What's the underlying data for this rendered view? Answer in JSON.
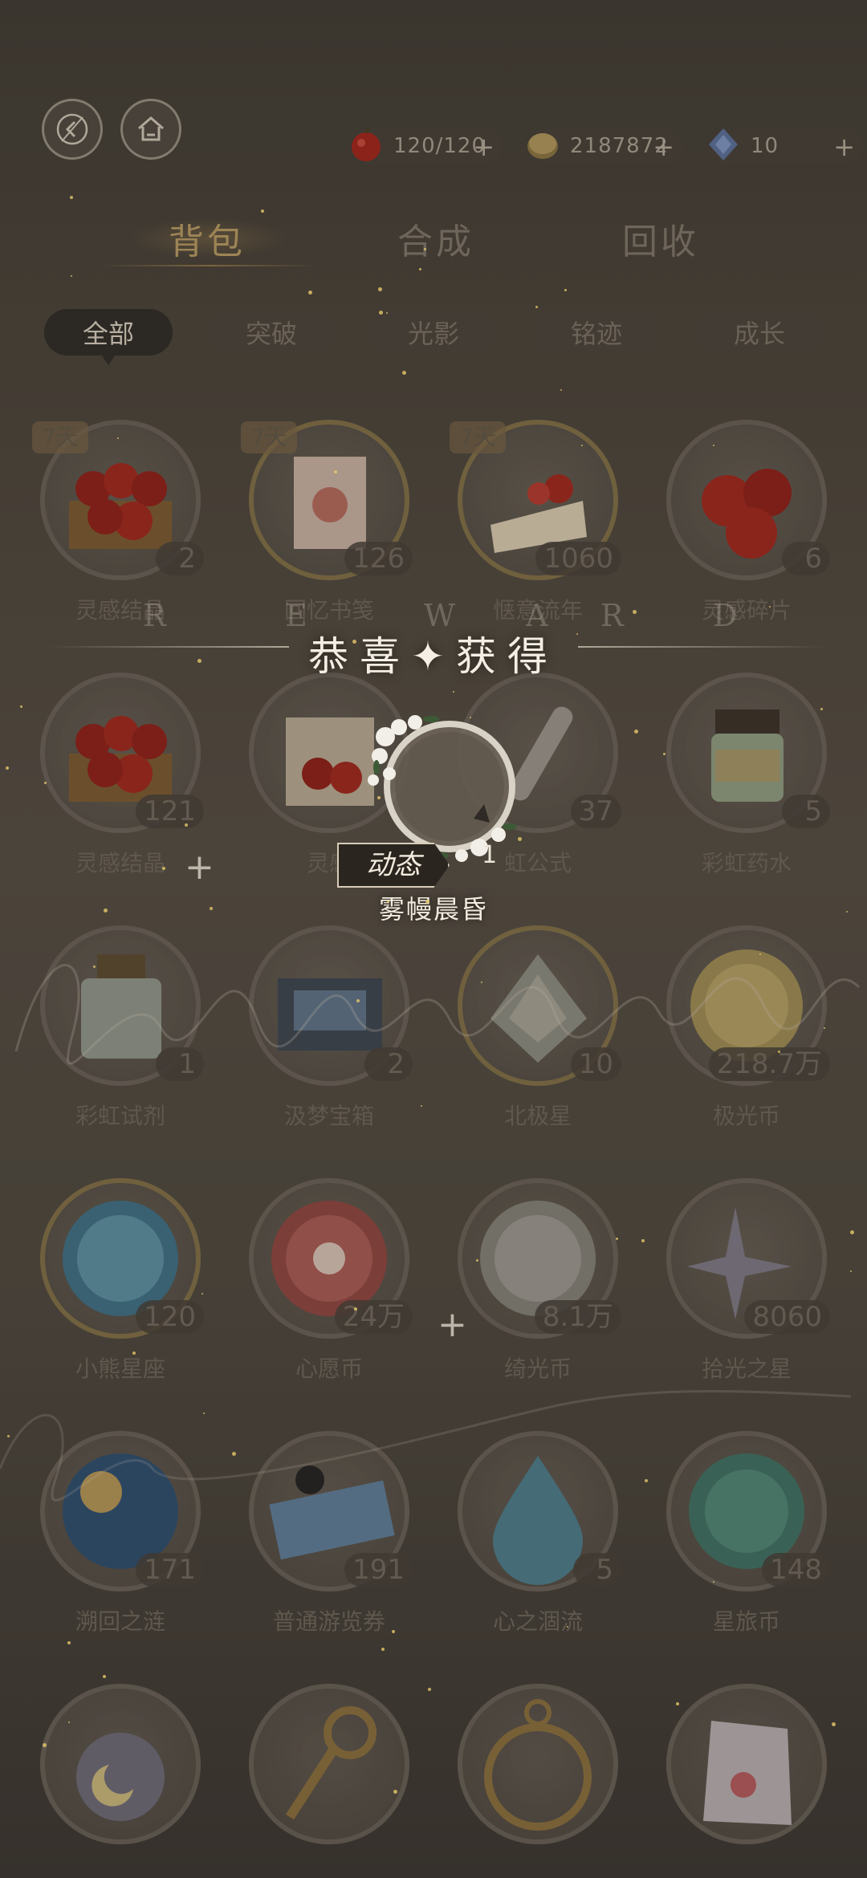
{
  "topbar": {
    "resources": [
      {
        "icon": "apple-icon",
        "value": "120/120",
        "plus": "+"
      },
      {
        "icon": "gold-coin-icon",
        "value": "2187872",
        "plus": "+"
      },
      {
        "icon": "blue-crystal-icon",
        "value": "10",
        "plus": "+"
      }
    ]
  },
  "tabs": {
    "main": [
      "背包",
      "合成",
      "回收"
    ],
    "sub": [
      "全部",
      "突破",
      "光影",
      "铭迹",
      "成长"
    ]
  },
  "items": [
    {
      "name": "灵感结晶",
      "count": "2",
      "badge": "7天",
      "icon": "apples-crate-icon"
    },
    {
      "name": "回忆书笺",
      "count": "126",
      "badge": "7天",
      "icon": "memory-letter-icon"
    },
    {
      "name": "惬意流年",
      "count": "1060",
      "badge": "7天",
      "icon": "strawberry-cake-icon"
    },
    {
      "name": "灵感碎片",
      "count": "6",
      "badge": "",
      "icon": "apples-icon"
    },
    {
      "name": "灵感结晶",
      "count": "121",
      "badge": "",
      "icon": "apples-crate-icon"
    },
    {
      "name": "灵感",
      "count": "",
      "badge": "",
      "icon": "apple-gift-box-icon"
    },
    {
      "name": "虹公式",
      "count": "37",
      "badge": "",
      "icon": "test-tube-icon"
    },
    {
      "name": "彩虹药水",
      "count": "5",
      "badge": "",
      "icon": "rainbow-jar-icon"
    },
    {
      "name": "彩虹试剂",
      "count": "1",
      "badge": "",
      "icon": "rainbow-bottle-icon"
    },
    {
      "name": "汲梦宝箱",
      "count": "2",
      "badge": "",
      "icon": "dream-chest-icon"
    },
    {
      "name": "北极星",
      "count": "10",
      "badge": "",
      "icon": "polaris-crystal-icon"
    },
    {
      "name": "极光币",
      "count": "218.7万",
      "badge": "",
      "icon": "aurora-coin-icon"
    },
    {
      "name": "小熊星座",
      "count": "120",
      "badge": "",
      "icon": "ursa-minor-coin-icon"
    },
    {
      "name": "心愿币",
      "count": "24万",
      "badge": "",
      "icon": "wish-coin-icon"
    },
    {
      "name": "绮光币",
      "count": "8.1万",
      "badge": "",
      "icon": "silver-coin-icon"
    },
    {
      "name": "拾光之星",
      "count": "8060",
      "badge": "",
      "icon": "star-sparkle-icon"
    },
    {
      "name": "溯回之涟",
      "count": "171",
      "badge": "",
      "icon": "sun-moon-medal-icon"
    },
    {
      "name": "普通游览券",
      "count": "191",
      "badge": "",
      "icon": "ticket-icon"
    },
    {
      "name": "心之涸流",
      "count": "5",
      "badge": "",
      "icon": "water-drop-icon"
    },
    {
      "name": "星旅币",
      "count": "148",
      "badge": "",
      "icon": "green-coin-icon"
    },
    {
      "name": "",
      "count": "",
      "badge": "",
      "icon": "moon-bottle-icon"
    },
    {
      "name": "",
      "count": "",
      "badge": "",
      "icon": "ornate-key-icon"
    },
    {
      "name": "",
      "count": "",
      "badge": "",
      "icon": "astrolabe-icon"
    },
    {
      "name": "",
      "count": "",
      "badge": "",
      "icon": "candy-bag-icon"
    }
  ],
  "reward": {
    "letters": [
      "R",
      "E",
      "W",
      "A",
      "R",
      "D"
    ],
    "title": "恭喜✦获得",
    "tag": "动态",
    "count": "1",
    "name": "雾幔晨昏",
    "icon": "flower-frame-icon"
  },
  "colors": {
    "accent_gold": "#b89a62",
    "background": "#4a4339",
    "reward_text": "#f4eee4"
  }
}
